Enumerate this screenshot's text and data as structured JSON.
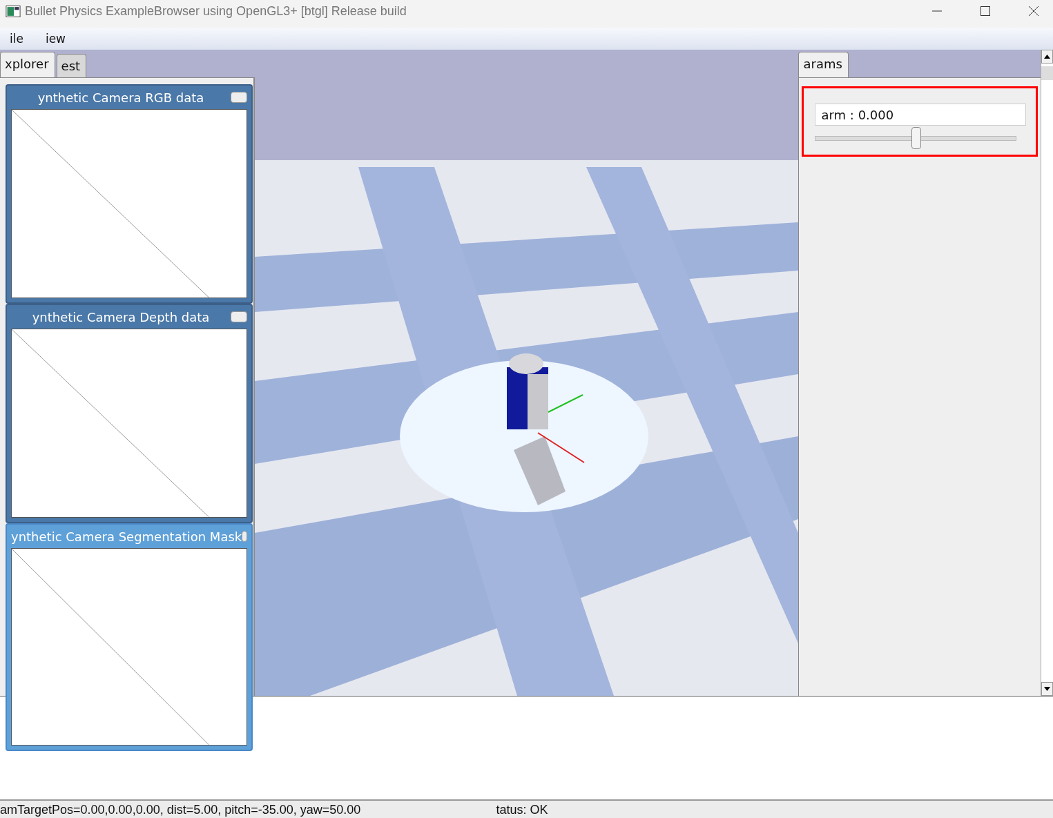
{
  "window": {
    "title": "Bullet Physics ExampleBrowser using OpenGL3+ [btgl] Release build"
  },
  "menu": [
    "ile",
    "iew"
  ],
  "left_tabs": [
    {
      "label": "xplorer",
      "selected": true
    },
    {
      "label": "est",
      "selected": false
    }
  ],
  "camera_windows": [
    {
      "title": "ynthetic Camera RGB data",
      "selected": false
    },
    {
      "title": "ynthetic Camera Depth data",
      "selected": false
    },
    {
      "title": "ynthetic Camera Segmentation Mask",
      "selected": true
    }
  ],
  "viewport": {
    "kind": "picture"
  },
  "right_tabs": [
    {
      "label": "arams",
      "selected": true
    }
  ],
  "params": [
    {
      "label": "arm : 0.000",
      "level": 0.5
    }
  ],
  "status_bar": {
    "camera": "amTargetPos=0.00,0.00,0.00, dist=5.00, pitch=-35.00, yaw=50.00",
    "status": "tatus: OK"
  }
}
